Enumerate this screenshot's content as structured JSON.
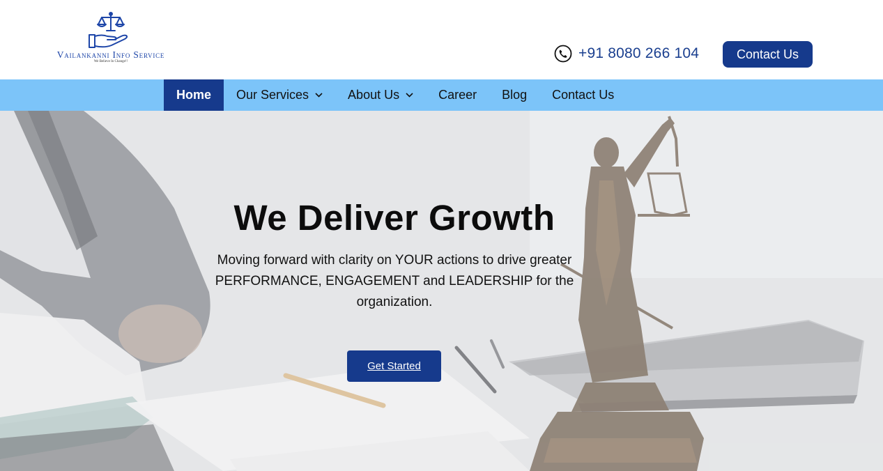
{
  "brand": {
    "name": "Vailankanni Info Service",
    "tagline": "We Believe In Change!!",
    "color": "#1d45a8"
  },
  "header": {
    "phone": "+91 8080 266 104",
    "phone_icon": "phone-icon",
    "contact_button": "Contact Us"
  },
  "nav": {
    "items": [
      {
        "label": "Home",
        "active": true,
        "has_dropdown": false
      },
      {
        "label": "Our Services",
        "active": false,
        "has_dropdown": true
      },
      {
        "label": "About Us",
        "active": false,
        "has_dropdown": true
      },
      {
        "label": "Career",
        "active": false,
        "has_dropdown": false
      },
      {
        "label": "Blog",
        "active": false,
        "has_dropdown": false
      },
      {
        "label": "Contact Us",
        "active": false,
        "has_dropdown": false
      }
    ],
    "background": "#7cc4f9",
    "active_background": "#163a8c"
  },
  "hero": {
    "title": "We Deliver Growth",
    "subtitle": "Moving forward with clarity on YOUR actions to drive greater PERFORMANCE, ENGAGEMENT and LEADERSHIP for the organization.",
    "cta": "Get Started",
    "cta_color": "#163a8c"
  }
}
